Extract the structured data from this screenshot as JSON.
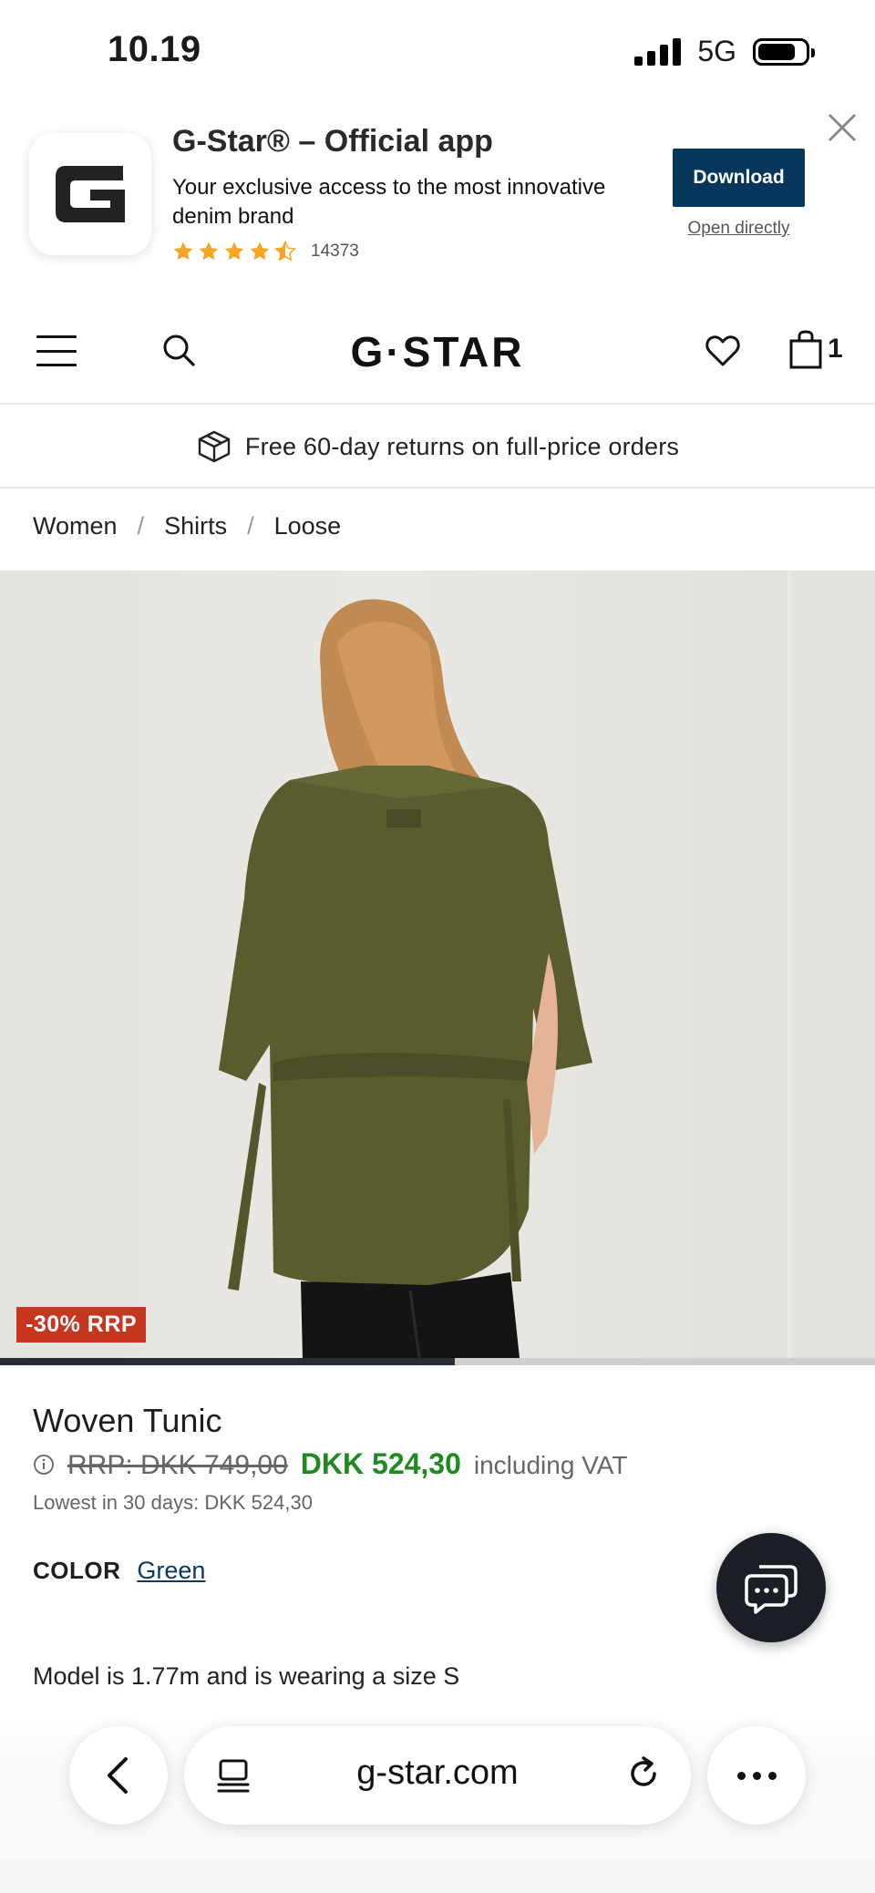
{
  "status_bar": {
    "time": "10.19",
    "network": "5G"
  },
  "app_banner": {
    "title": "G-Star® – Official app",
    "description": "Your exclusive access to the most innovative denim brand",
    "rating_stars": 4.5,
    "rating_count": "14373",
    "download_label": "Download",
    "open_label": "Open directly"
  },
  "nav": {
    "logo_text": "G·STAR",
    "bag_count": "1"
  },
  "returns": {
    "text": "Free 60-day returns on full-price orders"
  },
  "breadcrumb": {
    "items": [
      "Women",
      "Shirts",
      "Loose"
    ],
    "separator": "/"
  },
  "gallery": {
    "discount_badge": "-30% RRP",
    "progress_fraction": 0.52
  },
  "product": {
    "name": "Woven Tunic",
    "rrp": "RRP: DKK 749,00",
    "price": "DKK 524,30",
    "vat_note": "including VAT",
    "lowest_price": "Lowest in 30 days: DKK 524,30",
    "color_label": "COLOR",
    "color_value": "Green",
    "model_info": "Model is 1.77m and is wearing a size S"
  },
  "browser": {
    "url": "g-star.com"
  },
  "colors": {
    "download_button": "#063659",
    "sale_price": "#1f8a22",
    "badge": "#c7361e",
    "link": "#0a3a63",
    "star": "#f5a623"
  }
}
